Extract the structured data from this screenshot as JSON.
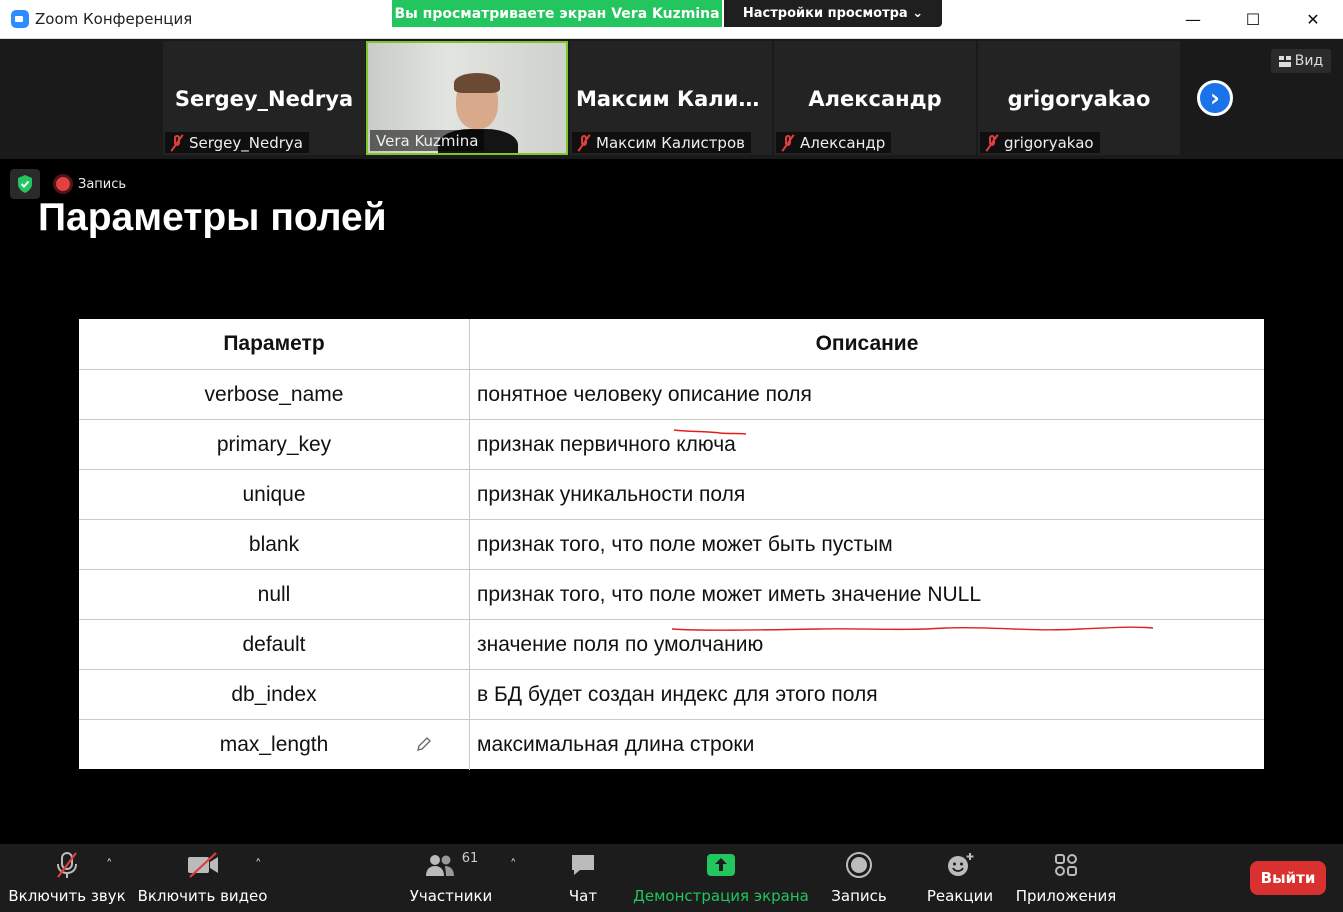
{
  "window": {
    "title": "Zoom Конференция",
    "minimize": "—",
    "maximize": "☐",
    "close": "✕"
  },
  "share_banner": {
    "text": "Вы просматриваете экран Vera Kuzmina",
    "view_settings": "Настройки просмотра ⌄"
  },
  "participants_strip": {
    "tiles": [
      {
        "big_name": "Sergey_Nedrya",
        "label": "Sergey_Nedrya",
        "muted": true
      },
      {
        "big_name": "",
        "label": "Vera Kuzmina",
        "muted": false,
        "video": true
      },
      {
        "big_name": "Максим  Калист...",
        "label": "Максим Калистров",
        "muted": true
      },
      {
        "big_name": "Александр",
        "label": "Александр",
        "muted": true
      },
      {
        "big_name": "grigoryakao",
        "label": "grigoryakao",
        "muted": true
      }
    ],
    "next_icon": "›",
    "view_label": "Вид"
  },
  "recording": {
    "label": "Запись"
  },
  "slide": {
    "title": "Параметры полей",
    "header": {
      "param": "Параметр",
      "desc": "Описание"
    },
    "rows": [
      {
        "param": "verbose_name",
        "desc": "понятное человеку описание поля"
      },
      {
        "param": "primary_key",
        "desc": "признак первичного ключа"
      },
      {
        "param": "unique",
        "desc": "признак уникальности поля"
      },
      {
        "param": "blank",
        "desc": "признак того, что поле может быть пустым"
      },
      {
        "param": "null",
        "desc": "признак того, что поле может иметь значение NULL"
      },
      {
        "param": "default",
        "desc": "значение поля по умолчанию"
      },
      {
        "param": "db_index",
        "desc": "в БД будет создан индекс для этого поля"
      },
      {
        "param": "max_length",
        "desc": "максимальная длина строки"
      }
    ],
    "annotation_color": "#e02020"
  },
  "toolbar": {
    "unmute": "Включить звук",
    "start_video": "Включить видео",
    "participants": "Участники",
    "participants_count": "61",
    "chat": "Чат",
    "share": "Демонстрация экрана",
    "record": "Запись",
    "reactions": "Реакции",
    "apps": "Приложения",
    "leave": "Выйти",
    "caret": "˄"
  },
  "colors": {
    "accent_green": "#22c55e",
    "zoom_blue": "#2d8cff",
    "leave_red": "#d8312f",
    "muted_red": "#e03e3e"
  }
}
